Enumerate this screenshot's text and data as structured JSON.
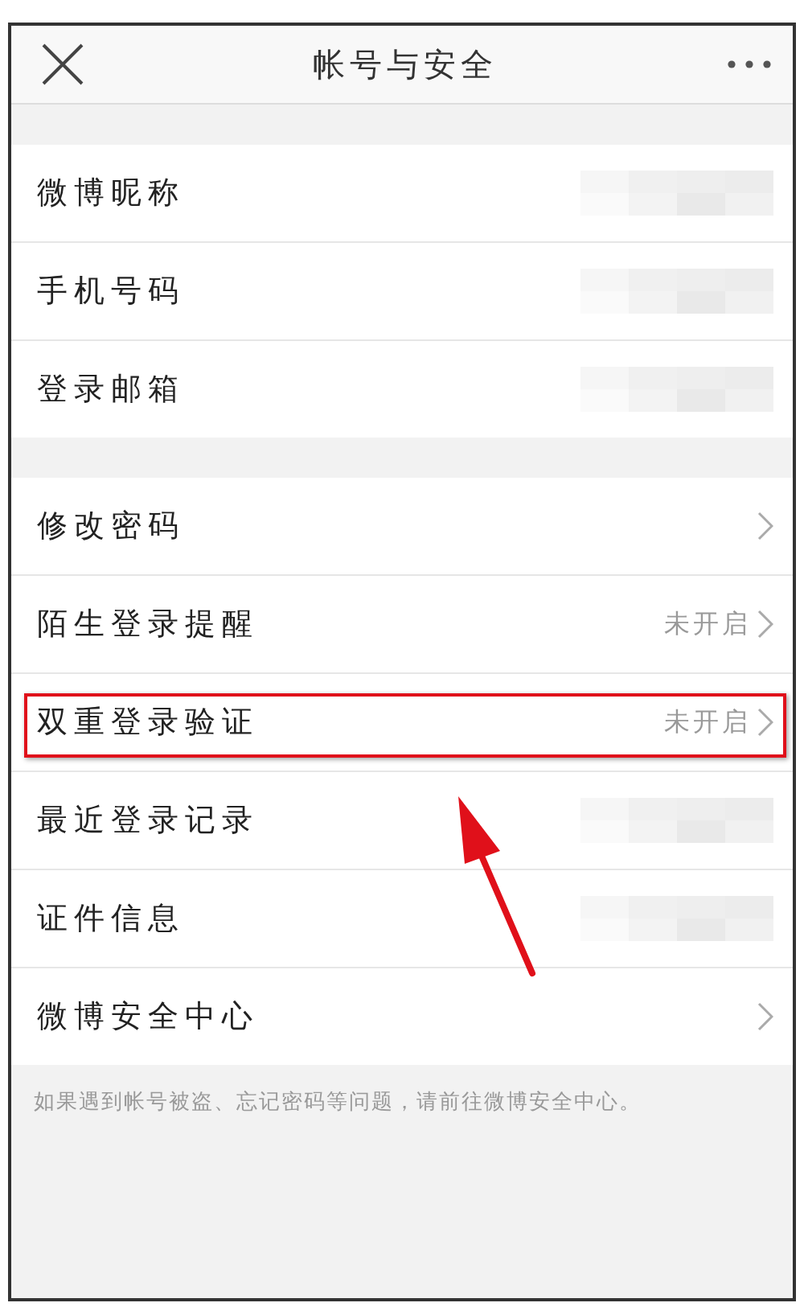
{
  "header": {
    "title": "帐号与安全"
  },
  "sections": [
    {
      "items": [
        {
          "label": "微博昵称",
          "kind": "hidden-value",
          "highlighted": false
        },
        {
          "label": "手机号码",
          "kind": "hidden-value",
          "highlighted": false
        },
        {
          "label": "登录邮箱",
          "kind": "hidden-value",
          "highlighted": false
        }
      ]
    },
    {
      "items": [
        {
          "label": "修改密码",
          "kind": "link",
          "highlighted": false
        },
        {
          "label": "陌生登录提醒",
          "kind": "link",
          "status": "未开启",
          "highlighted": false
        },
        {
          "label": "双重登录验证",
          "kind": "link",
          "status": "未开启",
          "highlighted": true
        },
        {
          "label": "最近登录记录",
          "kind": "hidden-value",
          "highlighted": false
        },
        {
          "label": "证件信息",
          "kind": "hidden-value",
          "highlighted": false
        },
        {
          "label": "微博安全中心",
          "kind": "link",
          "highlighted": false
        }
      ]
    }
  ],
  "footer_note": "如果遇到帐号被盗、忘记密码等问题，请前往微博安全中心。",
  "annotation": {
    "kind": "arrow"
  }
}
